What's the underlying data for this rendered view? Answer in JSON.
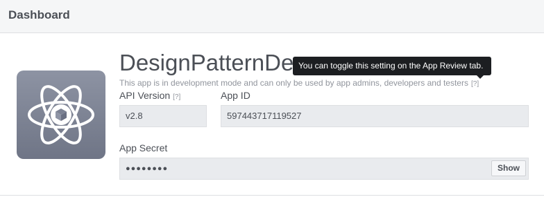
{
  "header": {
    "title": "Dashboard"
  },
  "app": {
    "name": "DesignPatternDemo",
    "dev_note": "This app is in development mode and can only be used by app admins, developers and testers",
    "help_mark": "[?]",
    "tooltip": "You can toggle this setting on the App Review tab.",
    "icon": "atom-icon"
  },
  "api_version": {
    "label": "API Version",
    "help_mark": "[?]",
    "value": "v2.8"
  },
  "app_id": {
    "label": "App ID",
    "value": "597443717119527"
  },
  "app_secret": {
    "label": "App Secret",
    "value": "●●●●●●●●",
    "show_label": "Show"
  }
}
